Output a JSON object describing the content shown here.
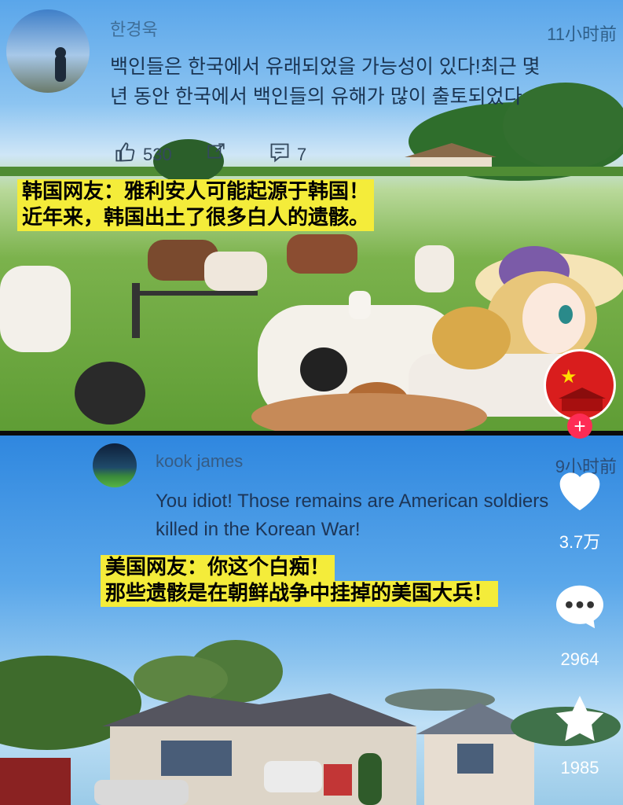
{
  "top_comment": {
    "username": "한경욱",
    "time": "11小时前",
    "text_line1": "백인들은 한국에서 유래되었을 가능성이 있다!최근 몇",
    "text_line2": "년 동안 한국에서 백인들의 유해가 많이 출토되었다",
    "like_count": "530",
    "reply_count": "7",
    "caption_line1": "韩国网友：雅利安人可能起源于韩国！",
    "caption_line2": "近年来，韩国出土了很多白人的遗骸。"
  },
  "bottom_comment": {
    "username": "kook james",
    "time": "9小时前",
    "text_line1": "You idiot! Those remains are American soldiers",
    "text_line2": "killed in the Korean War!",
    "caption_line1": "美国网友：你这个白痴！",
    "caption_line2": "那些遗骸是在朝鲜战争中挂掉的美国大兵！"
  },
  "sidebar": {
    "like_count": "3.7万",
    "comment_count": "2964",
    "favorite_count": "1985"
  },
  "colors": {
    "caption_bg": "#f4ec3a",
    "follow_button": "#fe2c55"
  }
}
